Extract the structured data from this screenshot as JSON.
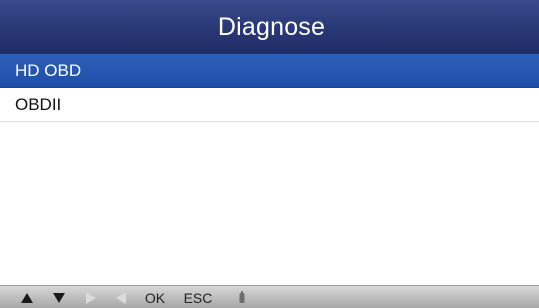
{
  "header": {
    "title": "Diagnose"
  },
  "menu": {
    "items": [
      {
        "label": "HD OBD",
        "selected": true
      },
      {
        "label": "OBDII",
        "selected": false
      }
    ]
  },
  "keybar": {
    "ok_label": "OK",
    "esc_label": "ESC",
    "icons": [
      "up-arrow-icon",
      "down-arrow-icon",
      "right-arrow-icon",
      "left-arrow-icon",
      "help-icon"
    ]
  },
  "colors": {
    "titlebar": "#2b3a78",
    "selected_row": "#1f4ea8",
    "keybar": "#bdbdbd"
  }
}
